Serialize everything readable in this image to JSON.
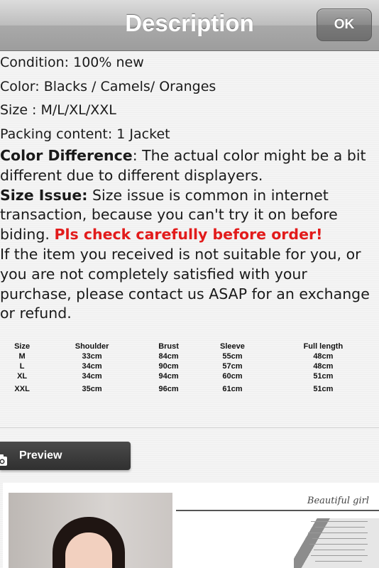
{
  "navbar": {
    "title": "Description",
    "ok_label": "OK"
  },
  "description": {
    "specs": [
      "Condition: 100% new",
      "Color: Blacks / Camels/ Oranges",
      "Size : M/L/XL/XXL",
      "Packing content: 1 Jacket"
    ],
    "color_difference_heading": "Color Difference",
    "color_difference_text": ": The actual color might be a bit different due to different displayers.",
    "size_issue_heading": "Size Issue:",
    "size_issue_text": " Size issue is common in internet transaction, because you can't try it on before biding. ",
    "size_issue_warning": "Pls check carefully before order!",
    "return_text": "If the item you received is not suitable for you, or you are not completely satisfied with your purchase, please contact us ASAP for an exchange or refund."
  },
  "size_table": {
    "headers": [
      "Size",
      "Shoulder",
      "Brust",
      "Sleeve",
      "Full length"
    ],
    "rows": [
      [
        "M",
        "33cm",
        "84cm",
        "55cm",
        "48cm"
      ],
      [
        "L",
        "34cm",
        "90cm",
        "57cm",
        "48cm"
      ],
      [
        "XL",
        "34cm",
        "94cm",
        "60cm",
        "51cm"
      ],
      [
        "XXL",
        "35cm",
        "96cm",
        "61cm",
        "51cm"
      ]
    ]
  },
  "preview": {
    "button_label": "Preview",
    "icon": "camera-icon",
    "graphic_script_text": "Beautiful girl"
  },
  "colors": {
    "warning_red": "#e21b1b",
    "preview_button_bg": "#3a3a3a"
  }
}
